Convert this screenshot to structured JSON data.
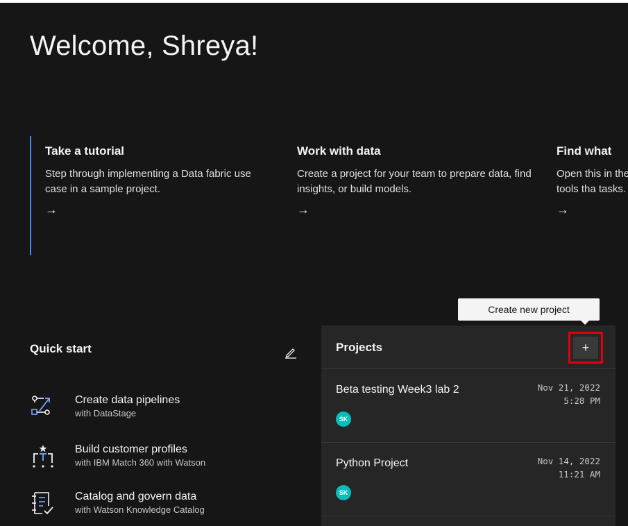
{
  "welcome": {
    "title": "Welcome, Shreya!"
  },
  "cards": [
    {
      "title": "Take a tutorial",
      "desc": "Step through implementing a Data fabric use case in a sample project.",
      "arrow": "→"
    },
    {
      "title": "Work with data",
      "desc": "Create a project for your team to prepare data, find insights, or build models.",
      "arrow": "→"
    },
    {
      "title": "Find what",
      "desc": "Open this in the tools tha tasks.",
      "arrow": "→"
    }
  ],
  "quick_start": {
    "title": "Quick start",
    "items": [
      {
        "title": "Create data pipelines",
        "subtitle": "with DataStage",
        "icon": "pipeline-icon"
      },
      {
        "title": "Build customer profiles",
        "subtitle": "with IBM Match 360 with Watson",
        "icon": "customer-profile-icon"
      },
      {
        "title": "Catalog and govern data",
        "subtitle": "with Watson Knowledge Catalog",
        "icon": "catalog-icon"
      }
    ]
  },
  "projects": {
    "title": "Projects",
    "add_label": "+",
    "tooltip": "Create new project",
    "rows": [
      {
        "name": "Beta testing Week3 lab 2",
        "date": "Nov 21, 2022",
        "time": "5:28 PM",
        "avatar": "SK"
      },
      {
        "name": "Python Project",
        "date": "Nov 14, 2022",
        "time": "11:21 AM",
        "avatar": "SK"
      }
    ]
  },
  "colors": {
    "accent": "#4589ff",
    "highlight": "#e00010",
    "avatar": "#08bdba"
  }
}
